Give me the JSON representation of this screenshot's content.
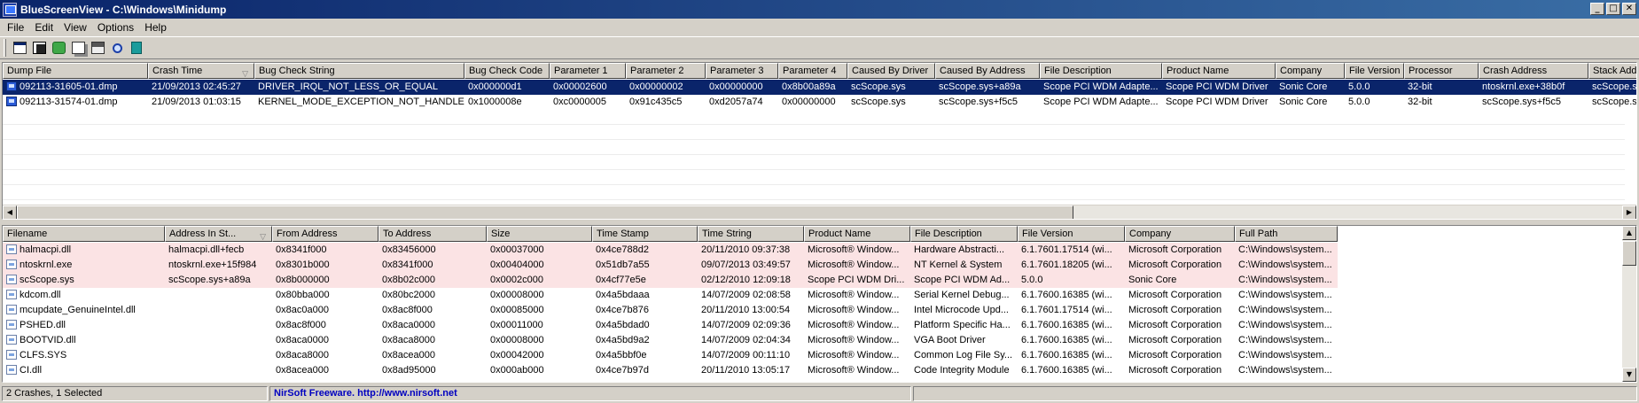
{
  "window": {
    "title": "BlueScreenView  -  C:\\Windows\\Minidump",
    "controls": [
      "minimize",
      "maximize",
      "close"
    ]
  },
  "menu": [
    "File",
    "Edit",
    "View",
    "Options",
    "Help"
  ],
  "toolbar": {
    "icons": [
      "properties-icon",
      "save-icon",
      "refresh-icon",
      "copy-icon",
      "options-icon",
      "find-icon",
      "exit-icon"
    ]
  },
  "top_list": {
    "columns": [
      "Dump File",
      "Crash Time",
      "Bug Check String",
      "Bug Check Code",
      "Parameter 1",
      "Parameter 2",
      "Parameter 3",
      "Parameter 4",
      "Caused By Driver",
      "Caused By Address",
      "File Description",
      "Product Name",
      "Company",
      "File Version",
      "Processor",
      "Crash Address",
      "Stack Address"
    ],
    "sort_column": "Crash Time",
    "rows": [
      [
        "092113-31605-01.dmp",
        "21/09/2013 02:45:27",
        "DRIVER_IRQL_NOT_LESS_OR_EQUAL",
        "0x000000d1",
        "0x00002600",
        "0x00000002",
        "0x00000000",
        "0x8b00a89a",
        "scScope.sys",
        "scScope.sys+a89a",
        "Scope PCI WDM Adapte...",
        "Scope PCI WDM Driver",
        "Sonic Core",
        "5.0.0",
        "32-bit",
        "ntoskrnl.exe+38b0f",
        "scScope.sys"
      ],
      [
        "092113-31574-01.dmp",
        "21/09/2013 01:03:15",
        "KERNEL_MODE_EXCEPTION_NOT_HANDLED",
        "0x1000008e",
        "0xc0000005",
        "0x91c435c5",
        "0xd2057a74",
        "0x00000000",
        "scScope.sys",
        "scScope.sys+f5c5",
        "Scope PCI WDM Adapte...",
        "Scope PCI WDM Driver",
        "Sonic Core",
        "5.0.0",
        "32-bit",
        "scScope.sys+f5c5",
        "scScope.sys"
      ]
    ],
    "selected_row": 0
  },
  "bottom_list": {
    "columns": [
      "Filename",
      "Address In St...",
      "From Address",
      "To Address",
      "Size",
      "Time Stamp",
      "Time String",
      "Product Name",
      "File Description",
      "File Version",
      "Company",
      "Full Path"
    ],
    "sort_column": "Address In St...",
    "rows": [
      [
        "halmacpi.dll",
        "halmacpi.dll+fecb",
        "0x8341f000",
        "0x83456000",
        "0x00037000",
        "0x4ce788d2",
        "20/11/2010 09:37:38",
        "Microsoft® Window...",
        "Hardware Abstracti...",
        "6.1.7601.17514 (wi...",
        "Microsoft Corporation",
        "C:\\Windows\\system..."
      ],
      [
        "ntoskrnl.exe",
        "ntoskrnl.exe+15f984",
        "0x8301b000",
        "0x8341f000",
        "0x00404000",
        "0x51db7a55",
        "09/07/2013 03:49:57",
        "Microsoft® Window...",
        "NT Kernel & System",
        "6.1.7601.18205 (wi...",
        "Microsoft Corporation",
        "C:\\Windows\\system..."
      ],
      [
        "scScope.sys",
        "scScope.sys+a89a",
        "0x8b000000",
        "0x8b02c000",
        "0x0002c000",
        "0x4cf77e5e",
        "02/12/2010 12:09:18",
        "Scope PCI WDM Dri...",
        "Scope PCI WDM Ad...",
        "5.0.0",
        "Sonic Core",
        "C:\\Windows\\system..."
      ],
      [
        "kdcom.dll",
        "",
        "0x80bba000",
        "0x80bc2000",
        "0x00008000",
        "0x4a5bdaaa",
        "14/07/2009 02:08:58",
        "Microsoft® Window...",
        "Serial Kernel Debug...",
        "6.1.7600.16385 (wi...",
        "Microsoft Corporation",
        "C:\\Windows\\system..."
      ],
      [
        "mcupdate_GenuineIntel.dll",
        "",
        "0x8ac0a000",
        "0x8ac8f000",
        "0x00085000",
        "0x4ce7b876",
        "20/11/2010 13:00:54",
        "Microsoft® Window...",
        "Intel Microcode Upd...",
        "6.1.7601.17514 (wi...",
        "Microsoft Corporation",
        "C:\\Windows\\system..."
      ],
      [
        "PSHED.dll",
        "",
        "0x8ac8f000",
        "0x8aca0000",
        "0x00011000",
        "0x4a5bdad0",
        "14/07/2009 02:09:36",
        "Microsoft® Window...",
        "Platform Specific Ha...",
        "6.1.7600.16385 (wi...",
        "Microsoft Corporation",
        "C:\\Windows\\system..."
      ],
      [
        "BOOTVID.dll",
        "",
        "0x8aca0000",
        "0x8aca8000",
        "0x00008000",
        "0x4a5bd9a2",
        "14/07/2009 02:04:34",
        "Microsoft® Window...",
        "VGA Boot Driver",
        "6.1.7600.16385 (wi...",
        "Microsoft Corporation",
        "C:\\Windows\\system..."
      ],
      [
        "CLFS.SYS",
        "",
        "0x8aca8000",
        "0x8acea000",
        "0x00042000",
        "0x4a5bbf0e",
        "14/07/2009 00:11:10",
        "Microsoft® Window...",
        "Common Log File Sy...",
        "6.1.7600.16385 (wi...",
        "Microsoft Corporation",
        "C:\\Windows\\system..."
      ],
      [
        "CI.dll",
        "",
        "0x8acea000",
        "0x8ad95000",
        "0x000ab000",
        "0x4ce7b97d",
        "20/11/2010 13:05:17",
        "Microsoft® Window...",
        "Code Integrity Module",
        "6.1.7600.16385 (wi...",
        "Microsoft Corporation",
        "C:\\Windows\\system..."
      ]
    ],
    "highlighted_rows": [
      0,
      1,
      2
    ]
  },
  "status": {
    "counts": "2 Crashes, 1 Selected",
    "link": "NirSoft Freeware.  http://www.nirsoft.net"
  },
  "colors": {
    "title_start": "#0a246a",
    "title_end": "#3a6ea5",
    "selection": "#0a246a",
    "highlight_row": "#fbe3e4",
    "link": "#0000c0"
  }
}
